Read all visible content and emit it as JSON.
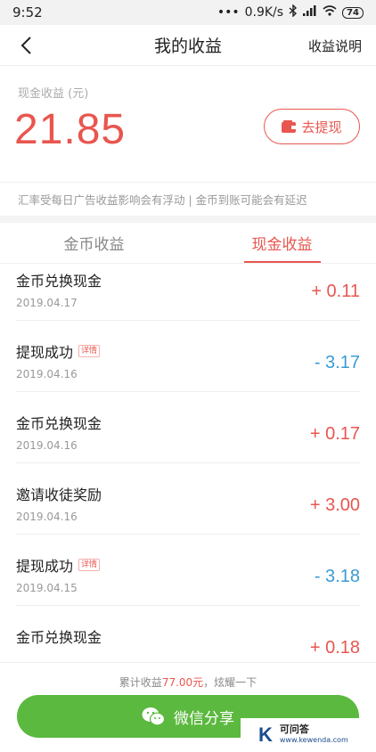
{
  "status_bar": {
    "time": "9:52",
    "network": "0.9K/s",
    "battery": "74"
  },
  "nav": {
    "title": "我的收益",
    "right_link": "收益说明"
  },
  "balance": {
    "label": "现金收益 (元)",
    "amount": "21.85",
    "withdraw_label": "去提现"
  },
  "notice": "汇率受每日广告收益影响会有浮动 | 金币到账可能会有延迟",
  "tabs": [
    {
      "label": "金币收益",
      "active": false
    },
    {
      "label": "现金收益",
      "active": true
    }
  ],
  "records": [
    {
      "title": "金币兑换现金",
      "date": "2019.04.17",
      "amount": "+ 0.11",
      "detail_tag": ""
    },
    {
      "title": "提现成功",
      "date": "2019.04.16",
      "amount": "- 3.17",
      "detail_tag": "详情"
    },
    {
      "title": "金币兑换现金",
      "date": "2019.04.16",
      "amount": "+ 0.17",
      "detail_tag": ""
    },
    {
      "title": "邀请收徒奖励",
      "date": "2019.04.16",
      "amount": "+ 3.00",
      "detail_tag": ""
    },
    {
      "title": "提现成功",
      "date": "2019.04.15",
      "amount": "- 3.18",
      "detail_tag": "详情"
    },
    {
      "title": "金币兑换现金",
      "date": "",
      "amount": "+ 0.18",
      "detail_tag": ""
    }
  ],
  "footer": {
    "prefix": "累计收益",
    "total": "77.00元",
    "suffix": "，炫耀一下",
    "share_label": "微信分享"
  },
  "watermark": {
    "logo": "K",
    "name": "可问答",
    "url": "www.kewenda.com"
  },
  "colors": {
    "accent": "#e8564f",
    "negative": "#3a9bd5",
    "share_green": "#5bb93f"
  }
}
